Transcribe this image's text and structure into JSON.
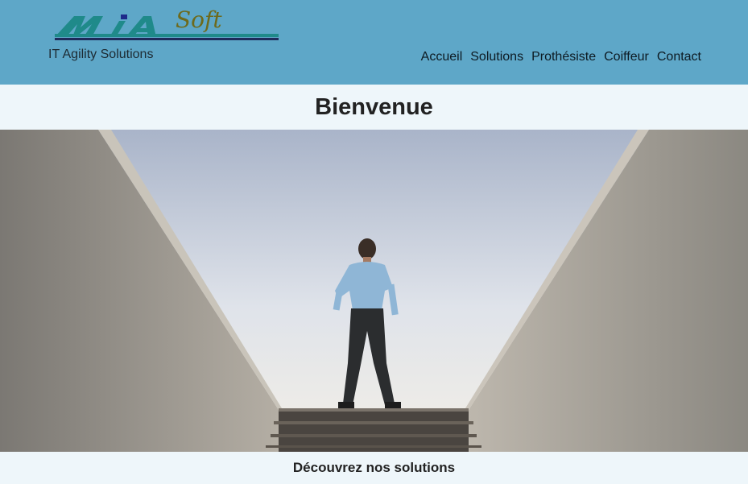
{
  "header": {
    "logo_text_main": "MIA",
    "logo_text_script": "Soft",
    "tagline": "IT Agility Solutions",
    "nav": [
      {
        "label": "Accueil"
      },
      {
        "label": "Solutions"
      },
      {
        "label": "Prothésiste"
      },
      {
        "label": "Coiffeur"
      },
      {
        "label": "Contact"
      }
    ]
  },
  "main": {
    "title": "Bienvenue",
    "hero_image": "man-standing-on-stairs-between-walls",
    "cta": "Découvrez nos solutions"
  },
  "colors": {
    "header_bg": "#5ea7c8",
    "page_bg": "#eef6fa",
    "logo_teal": "#1f8a8a",
    "logo_olive": "#6d6a1c"
  }
}
